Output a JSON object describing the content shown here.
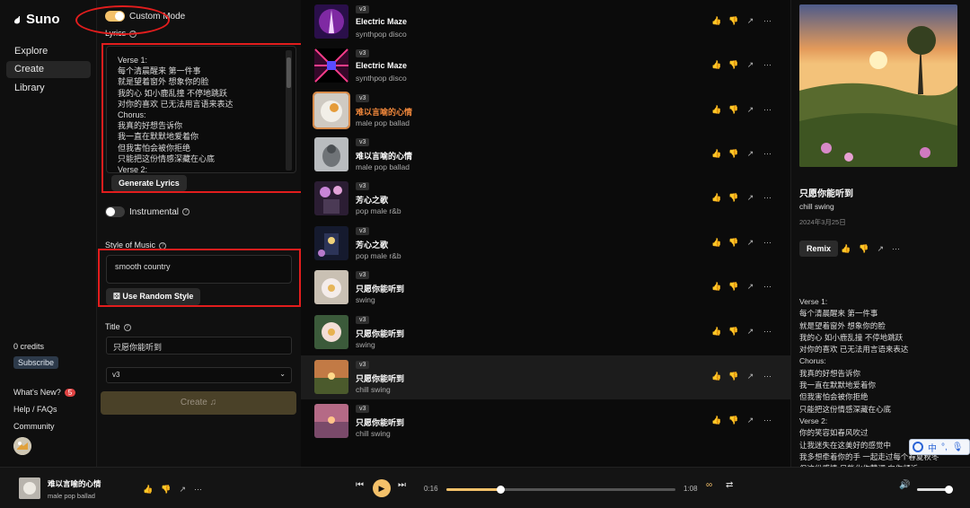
{
  "sidebar": {
    "brand": "Suno",
    "nav": [
      {
        "label": "Explore",
        "active": false
      },
      {
        "label": "Create",
        "active": true
      },
      {
        "label": "Library",
        "active": false
      }
    ],
    "credits": "0 credits",
    "subscribe_label": "Subscribe",
    "whats_new": "What's New?",
    "whats_new_count": "5",
    "help": "Help / FAQs",
    "community": "Community"
  },
  "form": {
    "custom_mode_label": "Custom Mode",
    "custom_mode_on": true,
    "lyrics_label": "Lyrics",
    "lyrics_lines": [
      "Verse 1:",
      "每个清晨醒来 第一件事",
      "就是望着窗外 想象你的脸",
      "我的心 如小鹿乱撞 不停地跳跃",
      "对你的喜欢 已无法用言语来表达",
      "Chorus:",
      "我真的好想告诉你",
      "我一直在默默地爱着你",
      "但我害怕会被你拒绝",
      "只能把这份情感深藏在心底",
      "Verse 2:"
    ],
    "generate_lyrics_label": "Generate Lyrics",
    "instrumental_label": "Instrumental",
    "instrumental_on": false,
    "style_label": "Style of Music",
    "style_value": "smooth country",
    "random_style_label": "Use Random Style",
    "title_label": "Title",
    "title_value": "只愿你能听到",
    "version_value": "v3",
    "create_label": "Create"
  },
  "songs": [
    {
      "version": "v3",
      "title": "Electric Maze",
      "style": "synthpop disco",
      "art": "neon-figure",
      "selected": false,
      "playing": false
    },
    {
      "version": "v3",
      "title": "Electric Maze",
      "style": "synthpop disco",
      "art": "neon-tunnel",
      "selected": false,
      "playing": false
    },
    {
      "version": "v3",
      "title": "难以言喻的心情",
      "style": "male pop ballad",
      "art": "white-bird",
      "selected": false,
      "playing": true
    },
    {
      "version": "v3",
      "title": "难以言喻的心情",
      "style": "male pop ballad",
      "art": "grey-bird",
      "selected": false,
      "playing": false
    },
    {
      "version": "v3",
      "title": "芳心之歌",
      "style": "pop male r&b",
      "art": "flower-window",
      "selected": false,
      "playing": false
    },
    {
      "version": "v3",
      "title": "芳心之歌",
      "style": "pop male r&b",
      "art": "night-window",
      "selected": false,
      "playing": false
    },
    {
      "version": "v3",
      "title": "只愿你能听到",
      "style": "swing",
      "art": "lotus",
      "selected": false,
      "playing": false
    },
    {
      "version": "v3",
      "title": "只愿你能听到",
      "style": "swing",
      "art": "lotus-green",
      "selected": false,
      "playing": false
    },
    {
      "version": "v3",
      "title": "只愿你能听到",
      "style": "chill swing",
      "art": "sunset-meadow",
      "selected": true,
      "playing": false
    },
    {
      "version": "v3",
      "title": "只愿你能听到",
      "style": "chill swing",
      "art": "sunset-lake",
      "selected": false,
      "playing": false
    }
  ],
  "detail": {
    "title": "只愿你能听到",
    "style": "chill swing",
    "date": "2024年3月25日",
    "remix_label": "Remix",
    "lyrics": "Verse 1:\n每个清晨醒来 第一件事\n就是望着窗外 想象你的脸\n我的心 如小鹿乱撞 不停地跳跃\n对你的喜欢 已无法用言语来表达\nChorus:\n我真的好想告诉你\n我一直在默默地爱着你\n但我害怕会被你拒绝\n只能把这份情感深藏在心底\nVerse 2:\n你的笑容如春风吹过\n让我迷失在这美好的感觉中\n我多想牵着你的手 一起走过每个春夏秋冬\n但这份感情 只能化作赞词 向你倾诉"
  },
  "ime": {
    "label": "中"
  },
  "player": {
    "title": "难以言喻的心情",
    "style": "male pop ballad",
    "current_time": "0:16",
    "total_time": "1:08",
    "progress": 0.235,
    "volume": 1.0
  },
  "colors": {
    "accent": "#f4c16a",
    "playing_title": "#f0873b",
    "annotation": "#e21d1d"
  }
}
